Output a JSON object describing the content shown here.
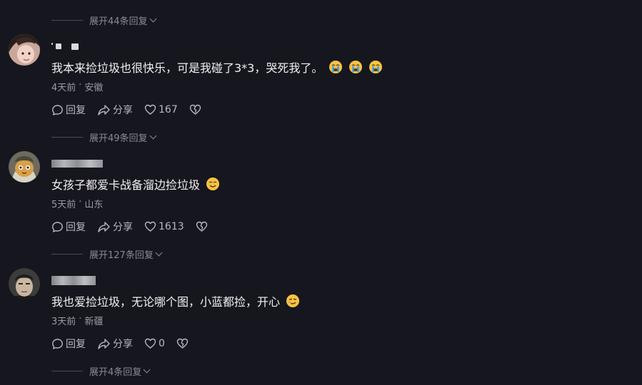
{
  "colors": {
    "background": "#16161e",
    "text": "#f0f0f2",
    "muted": "#9a9aa2"
  },
  "actions": {
    "reply_label": "回复",
    "share_label": "分享"
  },
  "expand_rows": [
    {
      "label": "展开44条回复"
    },
    {
      "label": "展开49条回复"
    },
    {
      "label": "展开127条回复"
    },
    {
      "label": "展开4条回复"
    }
  ],
  "comments": [
    {
      "text": "我本来捡垃圾也很快乐，可是我碰了3*3，哭死我了。",
      "emojis": [
        "crying-face-icon",
        "crying-face-icon",
        "crying-face-icon"
      ],
      "time": "4天前",
      "location": "安徽",
      "likes": "167"
    },
    {
      "text": "女孩子都爱卡战备溜边捡垃圾",
      "emojis": [
        "smiling-face-icon"
      ],
      "time": "5天前",
      "location": "山东",
      "likes": "1613"
    },
    {
      "text": "我也爱捡垃圾，无论哪个图，小蓝都捡，开心",
      "emojis": [
        "smirk-face-icon"
      ],
      "time": "3天前",
      "location": "新疆",
      "likes": "0"
    }
  ]
}
